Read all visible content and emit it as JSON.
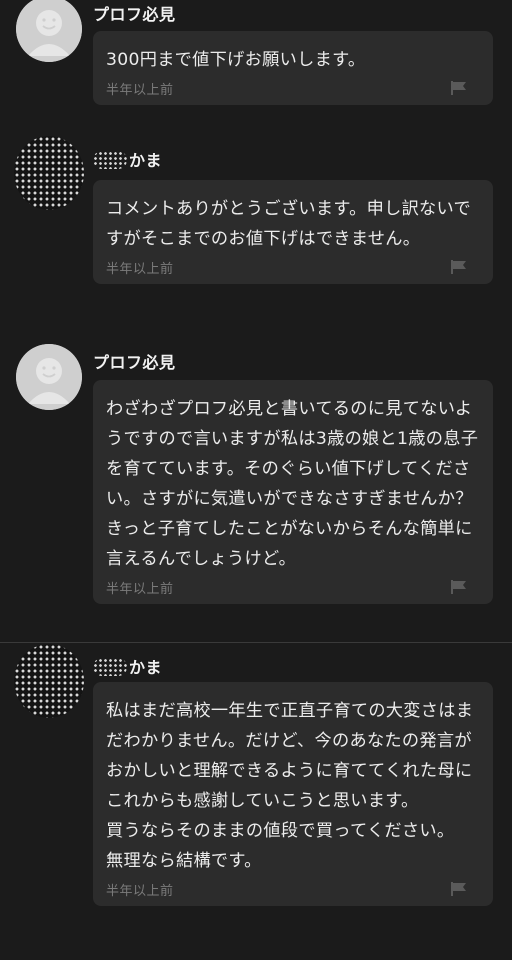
{
  "comments": [
    {
      "username": "プロフ必見",
      "avatar": "default-user-icon",
      "text": "300円まで値下げお願いします。",
      "time": "半年以上前"
    },
    {
      "username": "かま",
      "avatar": "dotted-masked-avatar",
      "text": "コメントありがとうございます。申し訳ないですがそこまでのお値下げはできません。",
      "time": "半年以上前"
    },
    {
      "username": "プロフ必見",
      "avatar": "default-user-icon",
      "text": "わざわざプロフ必見と書いてるのに見てないようですので言いますが私は3歳の娘と1歳の息子を育てています。そのぐらい値下げしてください。さすがに気遣いができなさすぎませんか？きっと子育てしたことがないからそんな簡単に言えるんでしょうけど。",
      "time": "半年以上前"
    },
    {
      "username": "かま",
      "avatar": "dotted-masked-avatar",
      "text": "私はまだ高校一年生で正直子育ての大変さはまだわかりません。だけど、今のあなたの発言がおかしいと理解できるように育ててくれた母にこれからも感謝していこうと思います。\n買うならそのままの値段で買ってください。\n無理なら結構です。",
      "time": "半年以上前"
    }
  ],
  "colors": {
    "background": "#1b1b1b",
    "bubble": "#2c2c2c",
    "text": "#ececec",
    "timestamp": "#7b7b7b"
  }
}
